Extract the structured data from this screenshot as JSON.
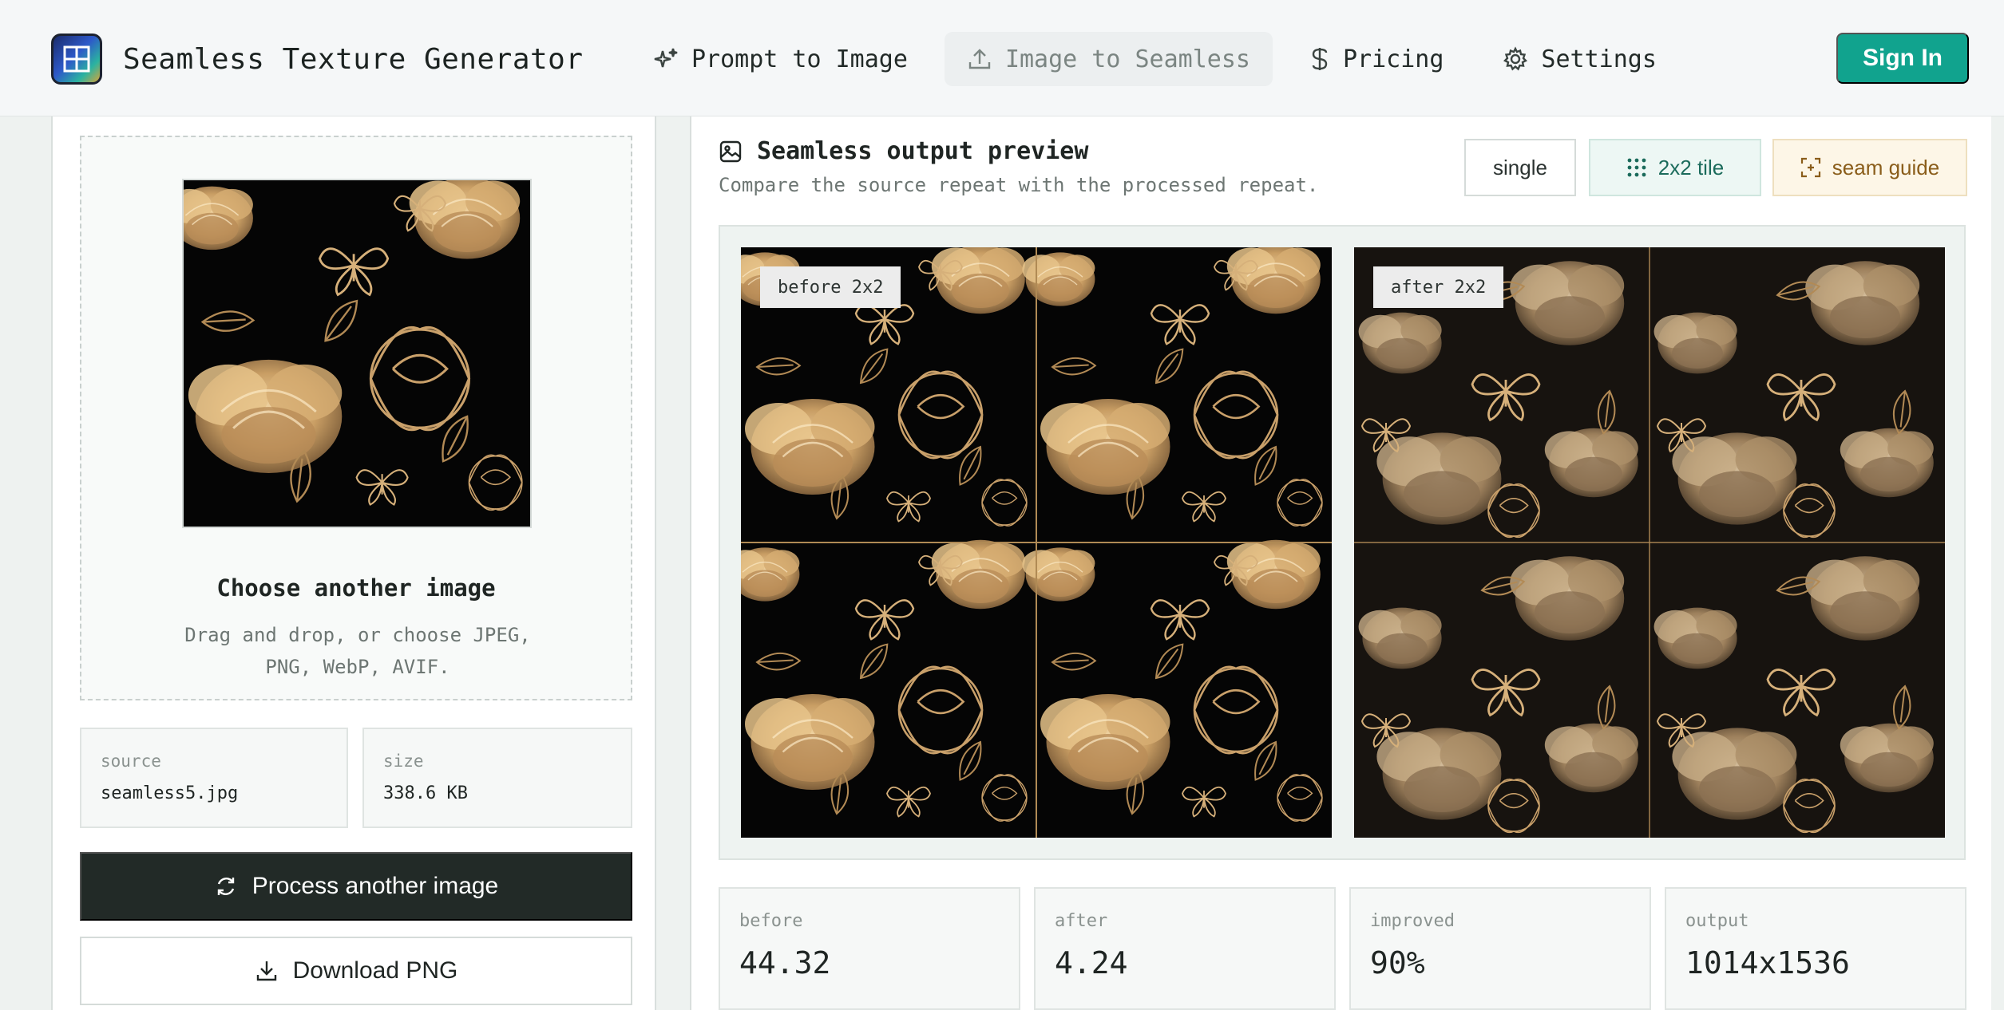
{
  "app": {
    "title": "Seamless Texture Generator",
    "logo_icon": "grid-tile-icon",
    "sign_in_label": "Sign In",
    "accent_color": "#11a38e"
  },
  "nav": {
    "items": [
      {
        "label": "Prompt to Image",
        "icon": "sparkles-icon",
        "active": false
      },
      {
        "label": "Image to Seamless",
        "icon": "upload-icon",
        "active": true
      },
      {
        "label": "Pricing",
        "icon": "dollar-icon",
        "active": false
      },
      {
        "label": "Settings",
        "icon": "gear-icon",
        "active": false
      }
    ]
  },
  "upload": {
    "title": "Choose another image",
    "hint": "Drag and drop, or choose JPEG, PNG, WebP, AVIF.",
    "source_label": "source",
    "source_value": "seamless5.jpg",
    "size_label": "size",
    "size_value": "338.6 KB",
    "process_label": "Process another image",
    "download_label": "Download PNG"
  },
  "preview": {
    "title": "Seamless output preview",
    "subtitle": "Compare the source repeat with the processed repeat.",
    "modes": [
      {
        "label": "single",
        "icon": "",
        "selected": false
      },
      {
        "label": "2x2 tile",
        "icon": "grid-dots-icon",
        "selected": true
      },
      {
        "label": "seam guide",
        "icon": "crosshair-icon",
        "selected": false
      }
    ],
    "before_label": "before 2x2",
    "after_label": "after 2x2"
  },
  "stats": [
    {
      "label": "before",
      "value": "44.32"
    },
    {
      "label": "after",
      "value": "4.24"
    },
    {
      "label": "improved",
      "value": "90%"
    },
    {
      "label": "output",
      "value": "1014x1536"
    }
  ]
}
